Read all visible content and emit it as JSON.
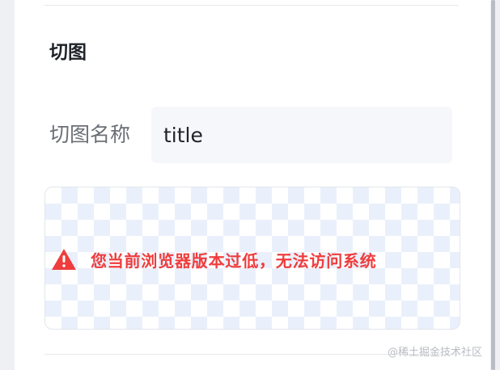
{
  "section": {
    "title": "切图"
  },
  "field": {
    "label": "切图名称",
    "value": "title"
  },
  "preview": {
    "warning_icon": "warning-icon",
    "warning_text": "您当前浏览器版本过低，无法访问系统",
    "warning_color": "#ef3d3d"
  },
  "watermark": {
    "text": "@稀土掘金技术社区"
  }
}
